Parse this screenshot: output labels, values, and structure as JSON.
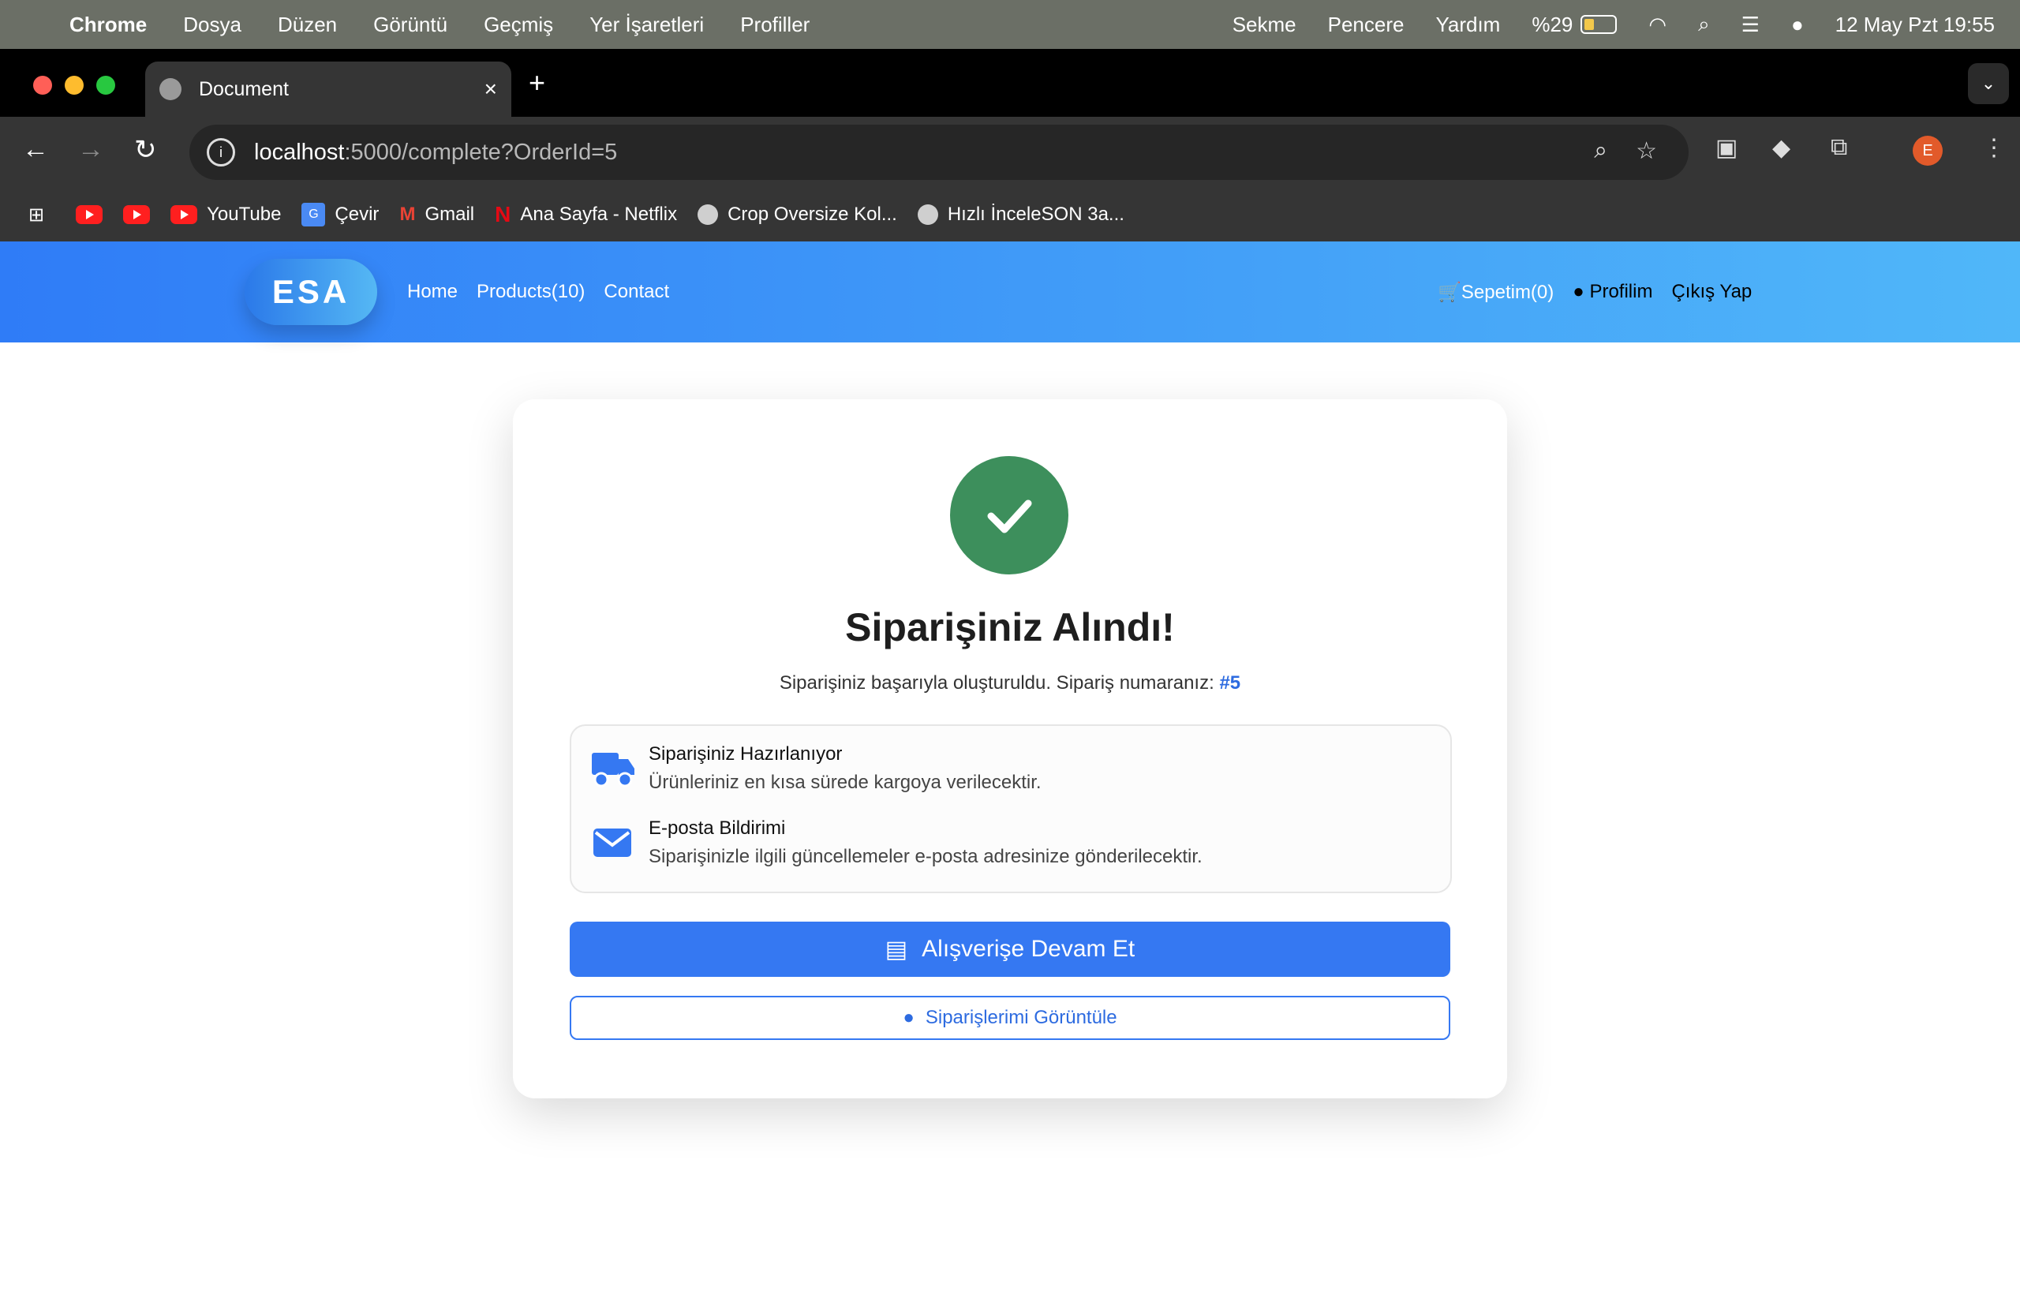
{
  "menubar": {
    "app_name": "Chrome",
    "items": [
      "Dosya",
      "Düzen",
      "Görüntü",
      "Geçmiş",
      "Yer İşaretleri",
      "Profiller"
    ],
    "right_items": [
      "Sekme",
      "Pencere",
      "Yardım"
    ],
    "battery": "%29",
    "datetime": "12 May Pzt  19:55"
  },
  "browser": {
    "tab_title": "Document",
    "url_host": "localhost",
    "url_path": ":5000/complete?OrderId=5",
    "profile_initial": "E",
    "bookmarks": [
      {
        "label": "",
        "icon": "youtube-icon"
      },
      {
        "label": "",
        "icon": "youtube-icon"
      },
      {
        "label": "YouTube",
        "icon": "youtube-icon"
      },
      {
        "label": "Çevir",
        "icon": "translate-icon"
      },
      {
        "label": "Gmail",
        "icon": "gmail-icon"
      },
      {
        "label": "Ana Sayfa - Netflix",
        "icon": "netflix-icon"
      },
      {
        "label": "Crop Oversize Kol...",
        "icon": "globe-icon"
      },
      {
        "label": "Hızlı İnceleSON 3a...",
        "icon": "globe-icon"
      }
    ]
  },
  "site": {
    "logo": "ESA",
    "nav": [
      "Home",
      "Products(10)",
      "Contact"
    ],
    "cart": "Sepetim(0)",
    "profile": "Profilim",
    "logout": "Çıkış Yap"
  },
  "order": {
    "headline": "Siparişiniz Alındı!",
    "subline": "Siparişiniz başarıyla oluşturuldu. Sipariş numaranız:",
    "order_number": "#5",
    "info_items": [
      {
        "title": "Siparişiniz Hazırlanıyor",
        "text": "Ürünleriniz en kısa sürede kargoya verilecektir.",
        "icon": "truck-icon"
      },
      {
        "title": "E-posta Bildirimi",
        "text": "Siparişinizle ilgili güncellemeler e-posta adresinize gönderilecektir.",
        "icon": "envelope-icon"
      }
    ],
    "continue_label": "Alışverişe Devam Et",
    "orders_label": "Siparişlerimi Görüntüle"
  }
}
